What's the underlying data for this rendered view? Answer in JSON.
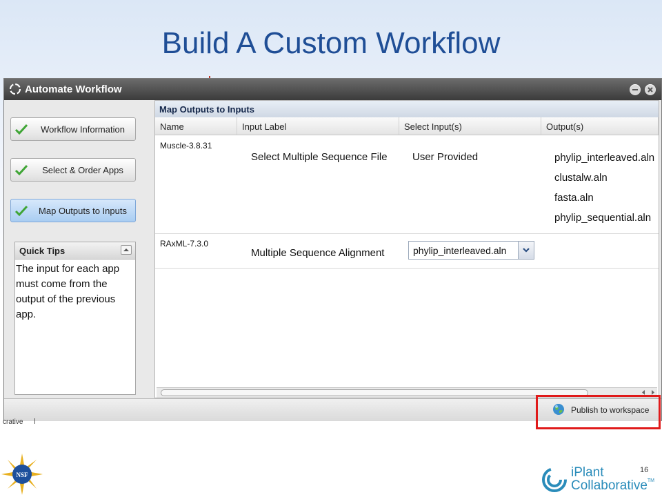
{
  "slide": {
    "title": "Build A Custom Workflow",
    "page_number": "16"
  },
  "window": {
    "title": "Automate Workflow"
  },
  "steps": [
    {
      "label": "Workflow Information",
      "done": true,
      "active": false
    },
    {
      "label": "Select & Order Apps",
      "done": true,
      "active": false
    },
    {
      "label": "Map Outputs to Inputs",
      "done": true,
      "active": true
    }
  ],
  "quick_tips": {
    "header": "Quick Tips",
    "body": "The input for each app must come from the output of the previous app."
  },
  "grid": {
    "title": "Map Outputs to Inputs",
    "columns": [
      "Name",
      "Input Label",
      "Select Input(s)",
      "Output(s)"
    ],
    "rows": [
      {
        "name": "Muscle-3.8.31",
        "input_label": "Select Multiple Sequence File",
        "select_input": "User Provided",
        "outputs": [
          "phylip_interleaved.aln",
          "clustalw.aln",
          "fasta.aln",
          "phylip_sequential.aln"
        ]
      },
      {
        "name": "RAxML-7.3.0",
        "input_label": "Multiple Sequence Alignment",
        "select_input": "phylip_interleaved.aln",
        "outputs": []
      }
    ]
  },
  "footer": {
    "publish_label": "Publish to workspace"
  },
  "background_fragments": {
    "partial_word": "crative"
  },
  "logos": {
    "iplant_line1": "iPlant",
    "iplant_line2": "Collaborative",
    "iplant_tm": "TM",
    "nsf": "NSF"
  },
  "colors": {
    "title": "#1f4e96",
    "highlight": "#e01a1a",
    "brand": "#2a8cba",
    "check": "#3fa535"
  }
}
